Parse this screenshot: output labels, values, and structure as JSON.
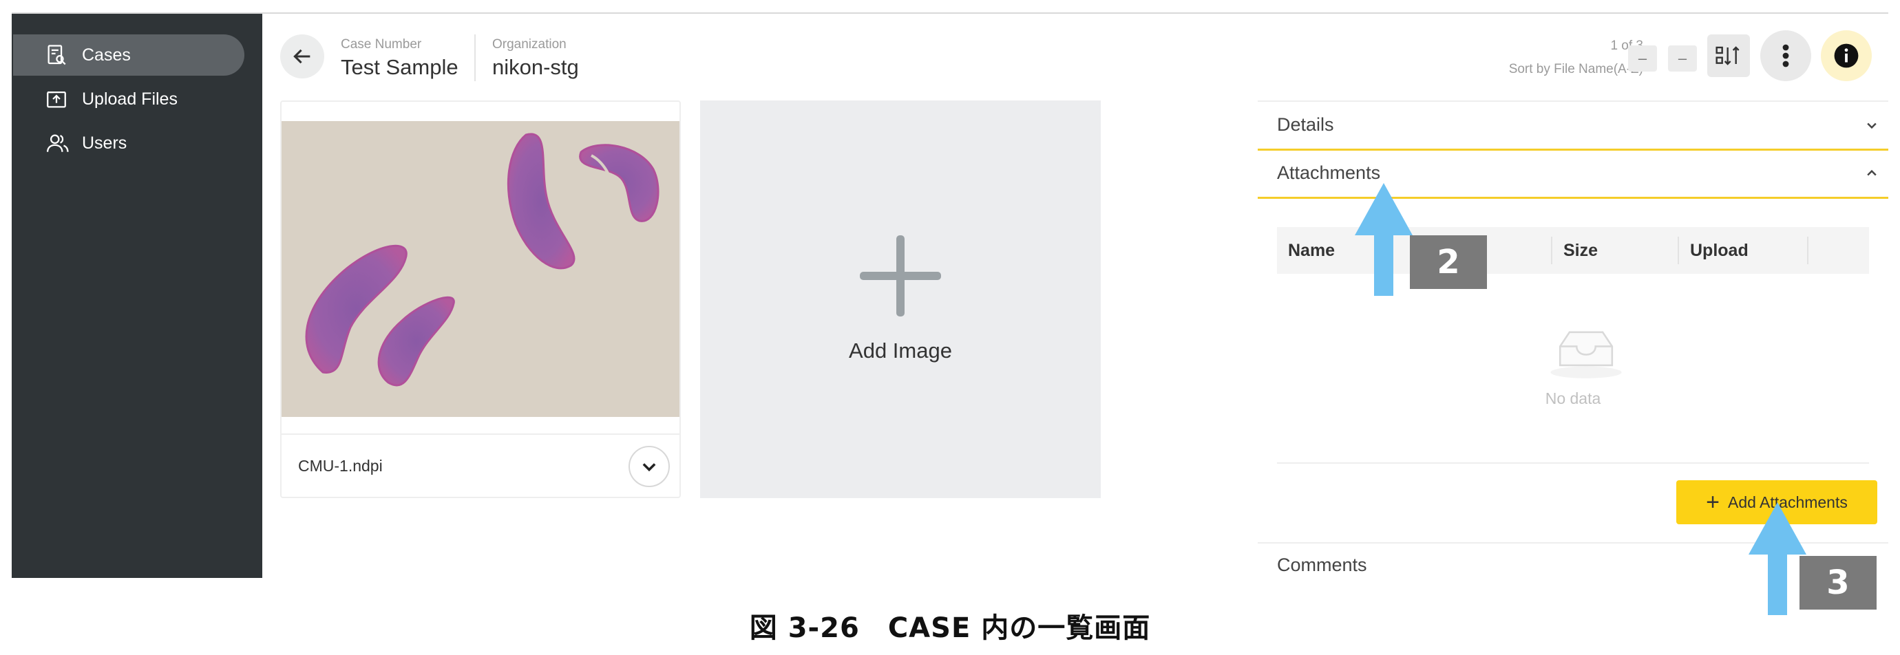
{
  "sidebar": {
    "items": [
      {
        "label": "Cases",
        "icon": "case-search-icon",
        "active": true
      },
      {
        "label": "Upload Files",
        "icon": "upload-icon",
        "active": false
      },
      {
        "label": "Users",
        "icon": "users-icon",
        "active": false
      }
    ]
  },
  "header": {
    "case_number_caption": "Case Number",
    "case_number": "Test Sample",
    "organization_caption": "Organization",
    "organization": "nikon-stg",
    "count": "1 of 3",
    "sort_label": "Sort by File Name(A-Z)",
    "minus_label_1": "–",
    "minus_label_2": "–"
  },
  "image_card": {
    "file_name": "CMU-1.ndpi"
  },
  "add_image": {
    "label": "Add Image"
  },
  "panel": {
    "details_label": "Details",
    "attachments_label": "Attachments",
    "columns": [
      "Name",
      "Size",
      "Upload"
    ],
    "no_data": "No data",
    "add_attachments_label": "Add Attachments",
    "comments_label": "Comments"
  },
  "annotations": {
    "callout_2": "2",
    "callout_3": "3",
    "arrow_color": "#6ec1f1"
  },
  "caption": "図 3-26　CASE 内の一覧画面",
  "colors": {
    "sidebar_bg": "#2f3437",
    "accent_yellow": "#fcd215",
    "info_bg": "#fdf3c9"
  }
}
